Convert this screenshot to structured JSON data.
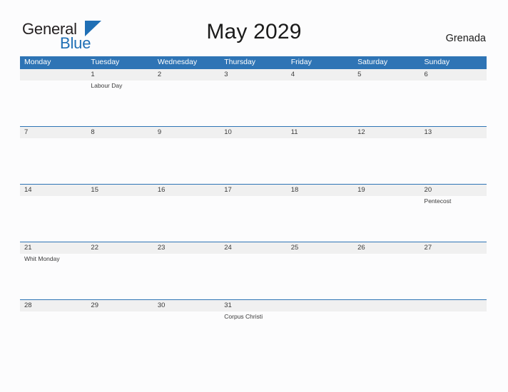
{
  "brand": {
    "name_part1": "General",
    "name_part2": "Blue",
    "accent_color": "#2e74b5"
  },
  "header": {
    "title": "May 2029",
    "country": "Grenada"
  },
  "calendar": {
    "weekdays": [
      "Monday",
      "Tuesday",
      "Wednesday",
      "Thursday",
      "Friday",
      "Saturday",
      "Sunday"
    ],
    "weeks": [
      [
        {
          "day": "",
          "event": ""
        },
        {
          "day": "1",
          "event": "Labour Day"
        },
        {
          "day": "2",
          "event": ""
        },
        {
          "day": "3",
          "event": ""
        },
        {
          "day": "4",
          "event": ""
        },
        {
          "day": "5",
          "event": ""
        },
        {
          "day": "6",
          "event": ""
        }
      ],
      [
        {
          "day": "7",
          "event": ""
        },
        {
          "day": "8",
          "event": ""
        },
        {
          "day": "9",
          "event": ""
        },
        {
          "day": "10",
          "event": ""
        },
        {
          "day": "11",
          "event": ""
        },
        {
          "day": "12",
          "event": ""
        },
        {
          "day": "13",
          "event": ""
        }
      ],
      [
        {
          "day": "14",
          "event": ""
        },
        {
          "day": "15",
          "event": ""
        },
        {
          "day": "16",
          "event": ""
        },
        {
          "day": "17",
          "event": ""
        },
        {
          "day": "18",
          "event": ""
        },
        {
          "day": "19",
          "event": ""
        },
        {
          "day": "20",
          "event": "Pentecost"
        }
      ],
      [
        {
          "day": "21",
          "event": "Whit Monday"
        },
        {
          "day": "22",
          "event": ""
        },
        {
          "day": "23",
          "event": ""
        },
        {
          "day": "24",
          "event": ""
        },
        {
          "day": "25",
          "event": ""
        },
        {
          "day": "26",
          "event": ""
        },
        {
          "day": "27",
          "event": ""
        }
      ],
      [
        {
          "day": "28",
          "event": ""
        },
        {
          "day": "29",
          "event": ""
        },
        {
          "day": "30",
          "event": ""
        },
        {
          "day": "31",
          "event": "Corpus Christi"
        },
        {
          "day": "",
          "event": ""
        },
        {
          "day": "",
          "event": ""
        },
        {
          "day": "",
          "event": ""
        }
      ]
    ]
  }
}
